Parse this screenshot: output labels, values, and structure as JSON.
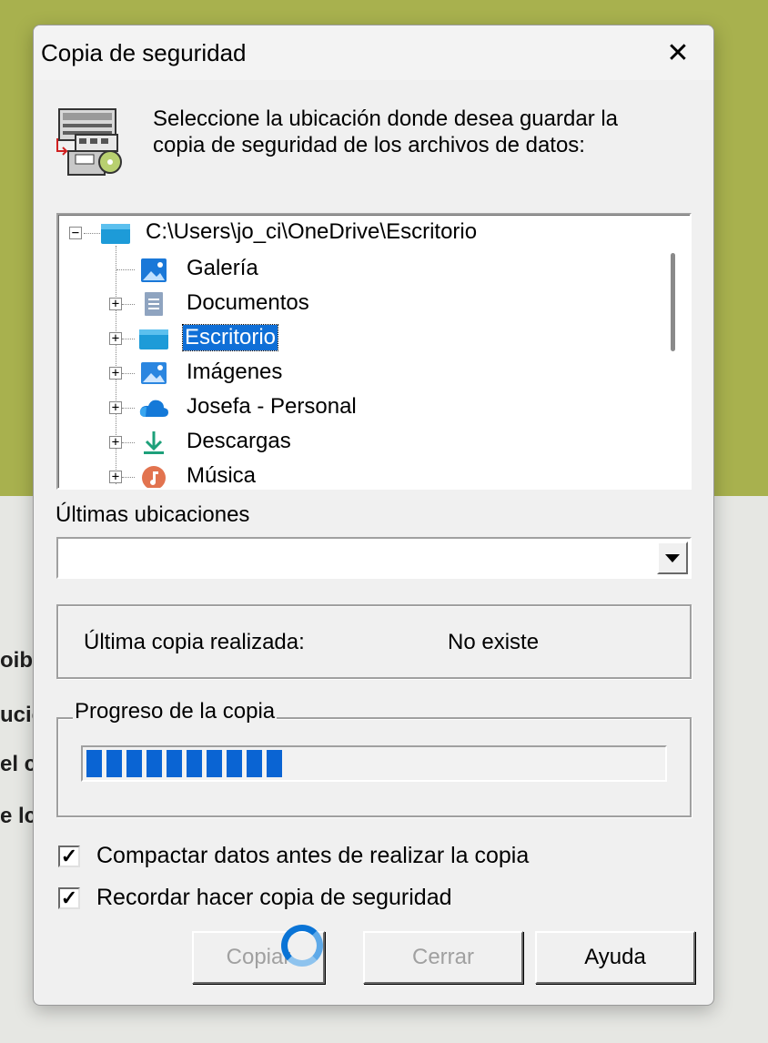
{
  "background": {
    "fragments": [
      "oibl",
      "ucic",
      "el c",
      "e lc"
    ]
  },
  "dialog": {
    "title": "Copia de seguridad",
    "close_symbol": "✕",
    "instruction_line1": "Seleccione la ubicación donde desea guardar la",
    "instruction_line2": "copia de seguridad de los archivos de datos:"
  },
  "tree": {
    "root": {
      "label": "C:\\Users\\jo_ci\\OneDrive\\Escritorio",
      "icon": "desktop-folder-icon",
      "expanded": true
    },
    "items": [
      {
        "label": "Galería",
        "icon": "gallery-icon",
        "has_children": false,
        "selected": false
      },
      {
        "label": "Documentos",
        "icon": "documents-icon",
        "has_children": true,
        "selected": false
      },
      {
        "label": "Escritorio",
        "icon": "desktop-folder-icon",
        "has_children": true,
        "selected": true
      },
      {
        "label": "Imágenes",
        "icon": "pictures-icon",
        "has_children": true,
        "selected": false
      },
      {
        "label": "Josefa - Personal",
        "icon": "onedrive-cloud-icon",
        "has_children": true,
        "selected": false
      },
      {
        "label": "Descargas",
        "icon": "downloads-icon",
        "has_children": true,
        "selected": false
      },
      {
        "label": "Música",
        "icon": "music-icon",
        "has_children": true,
        "selected": false
      }
    ]
  },
  "recent": {
    "label": "Últimas ubicaciones",
    "value": ""
  },
  "last_copy": {
    "label": "Última copia realizada:",
    "value": "No existe"
  },
  "progress": {
    "legend": "Progreso de la copia",
    "filled_blocks": 10,
    "fraction": 0.33
  },
  "options": {
    "compact_label": "Compactar datos antes de realizar la copia",
    "compact_checked": true,
    "remind_label": "Recordar hacer copia de seguridad",
    "remind_checked": true,
    "check_mark": "✓"
  },
  "buttons": {
    "copy_label": "Copiar",
    "close_label": "Cerrar",
    "help_label": "Ayuda"
  },
  "colors": {
    "accent": "#0a64d3",
    "selection": "#0f6fd7",
    "background_top": "#a8b14e"
  }
}
